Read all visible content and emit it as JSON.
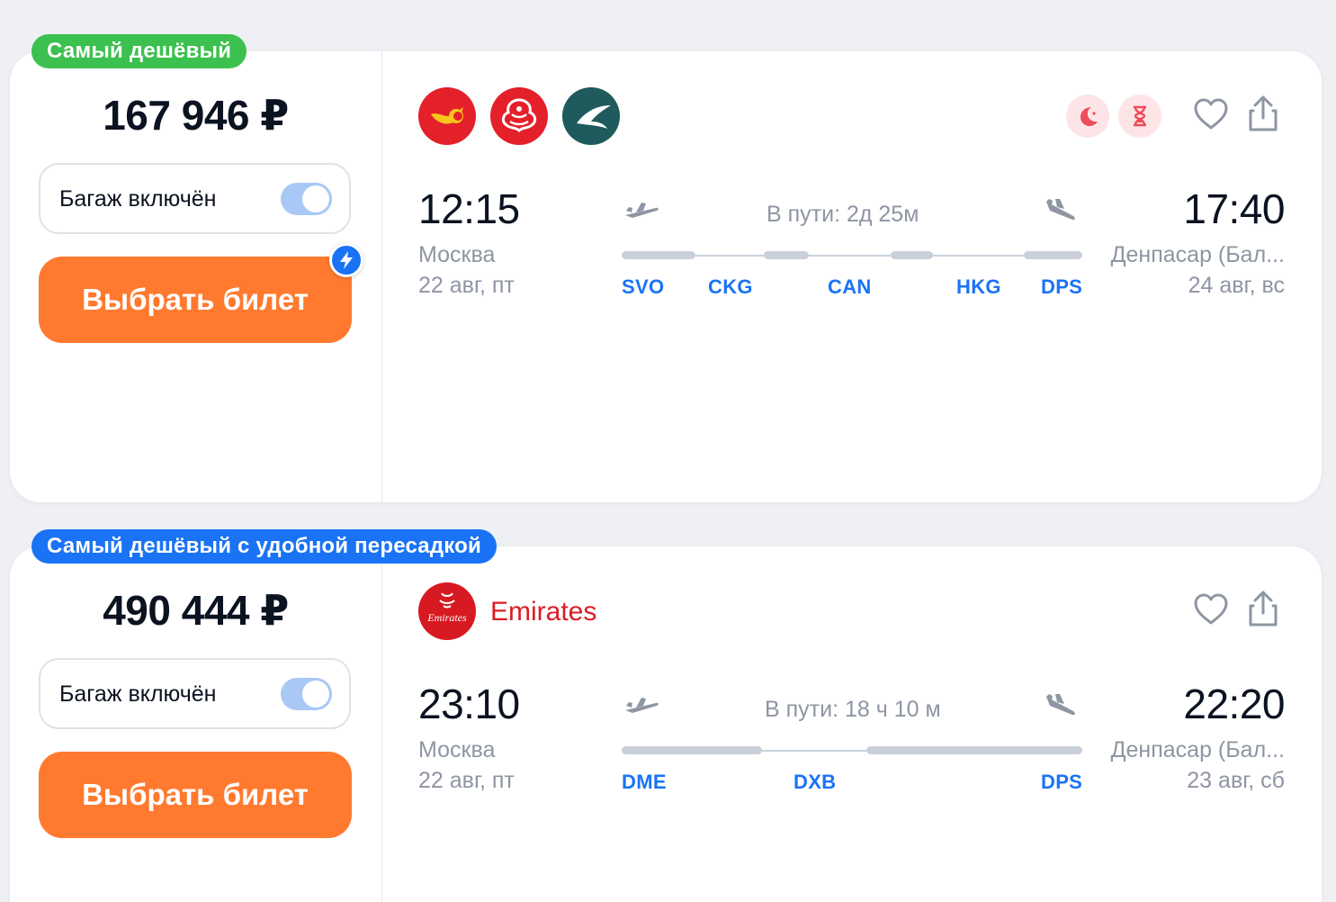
{
  "tickets": [
    {
      "badge": "Самый дешёвый",
      "badge_color": "#3cc04f",
      "price": "167 946 ₽",
      "baggage_label": "Багаж включён",
      "baggage_on": true,
      "buy_label": "Выбрать билет",
      "airline_logos": [
        "hainan-airlines-logo",
        "juneyao-airlines-logo",
        "cathay-pacific-logo"
      ],
      "flags": [
        "night-flight-icon",
        "long-layover-icon"
      ],
      "departure": {
        "time": "12:15",
        "city": "Москва",
        "date": "22 авг, пт"
      },
      "arrival": {
        "time": "17:40",
        "city": "Денпасар (Бал...",
        "date": "24 авг, вс"
      },
      "duration": "В пути: 2д 25м",
      "stops": [
        "SVO",
        "CKG",
        "CAN",
        "HKG",
        "DPS"
      ]
    },
    {
      "badge": "Самый дешёвый с удобной пересадкой",
      "badge_color": "#1a73f5",
      "price": "490 444 ₽",
      "baggage_label": "Багаж включён",
      "baggage_on": true,
      "buy_label": "Выбрать билет",
      "airline_name": "Emirates",
      "airline_logo_text": "Emirates",
      "departure": {
        "time": "23:10",
        "city": "Москва",
        "date": "22 авг, пт"
      },
      "arrival": {
        "time": "22:20",
        "city": "Денпасар (Бал...",
        "date": "23 авг, сб"
      },
      "duration": "В пути: 18 ч 10 м",
      "stops": [
        "DME",
        "DXB",
        "DPS"
      ]
    }
  ],
  "colors": {
    "accent_orange": "#ff7a2f",
    "link_blue": "#1a73f5",
    "toggle_on": "#a9c8f6",
    "emirates_red": "#d71921"
  }
}
